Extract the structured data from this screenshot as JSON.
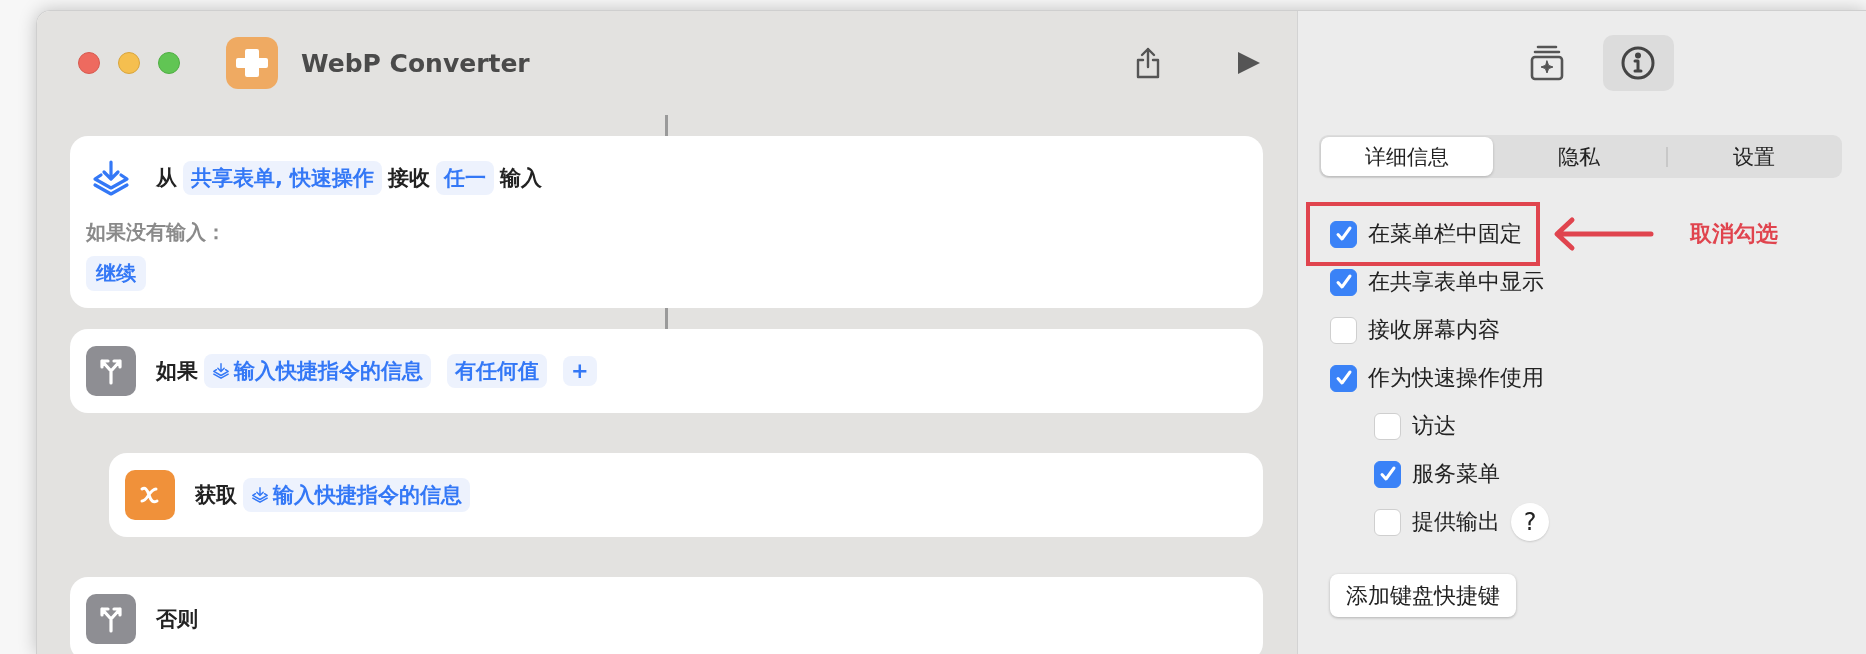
{
  "window": {
    "title": "WebP Converter"
  },
  "actions": [
    {
      "kind": "receive",
      "nested": false,
      "tokens": [
        {
          "kind": "text",
          "text": "从"
        },
        {
          "kind": "param",
          "text": "共享表单, 快速操作"
        },
        {
          "kind": "text",
          "text": "接收"
        },
        {
          "kind": "param",
          "text": "任一"
        },
        {
          "kind": "text",
          "text": "输入"
        }
      ],
      "fallback": {
        "label": "如果没有输入：",
        "value": "继续"
      }
    },
    {
      "kind": "if",
      "nested": false,
      "tokens": [
        {
          "kind": "text",
          "text": "如果"
        },
        {
          "kind": "variable",
          "text": "输入快捷指令的信息"
        },
        {
          "kind": "param",
          "text": "有任何值"
        },
        {
          "kind": "param",
          "text": "+"
        }
      ]
    },
    {
      "kind": "get_variable",
      "nested": true,
      "tokens": [
        {
          "kind": "text",
          "text": "获取"
        },
        {
          "kind": "variable",
          "text": "输入快捷指令的信息"
        }
      ]
    },
    {
      "kind": "otherwise",
      "nested": false,
      "tokens": [
        {
          "kind": "text",
          "text": "否则"
        }
      ]
    }
  ],
  "inspector": {
    "panes": [
      {
        "kind": "gallery",
        "selected": false
      },
      {
        "kind": "info",
        "selected": true
      }
    ],
    "tabs": [
      {
        "label": "详细信息",
        "selected": true
      },
      {
        "label": "隐私",
        "selected": false
      },
      {
        "label": "设置",
        "selected": false
      }
    ],
    "options": [
      {
        "label": "在菜单栏中固定",
        "checked": true,
        "highlighted": true
      },
      {
        "label": "在共享表单中显示",
        "checked": true,
        "highlighted": false
      },
      {
        "label": "接收屏幕内容",
        "checked": false,
        "highlighted": false
      },
      {
        "label": "作为快速操作使用",
        "checked": true,
        "highlighted": false,
        "children": [
          {
            "label": "访达",
            "checked": false,
            "highlighted": false
          },
          {
            "label": "服务菜单",
            "checked": true,
            "highlighted": false
          },
          {
            "label": "提供输出",
            "checked": false,
            "highlighted": false,
            "help": "?"
          }
        ]
      }
    ],
    "annotation": "取消勾选",
    "shortcut_button": "添加键盘快捷键"
  }
}
